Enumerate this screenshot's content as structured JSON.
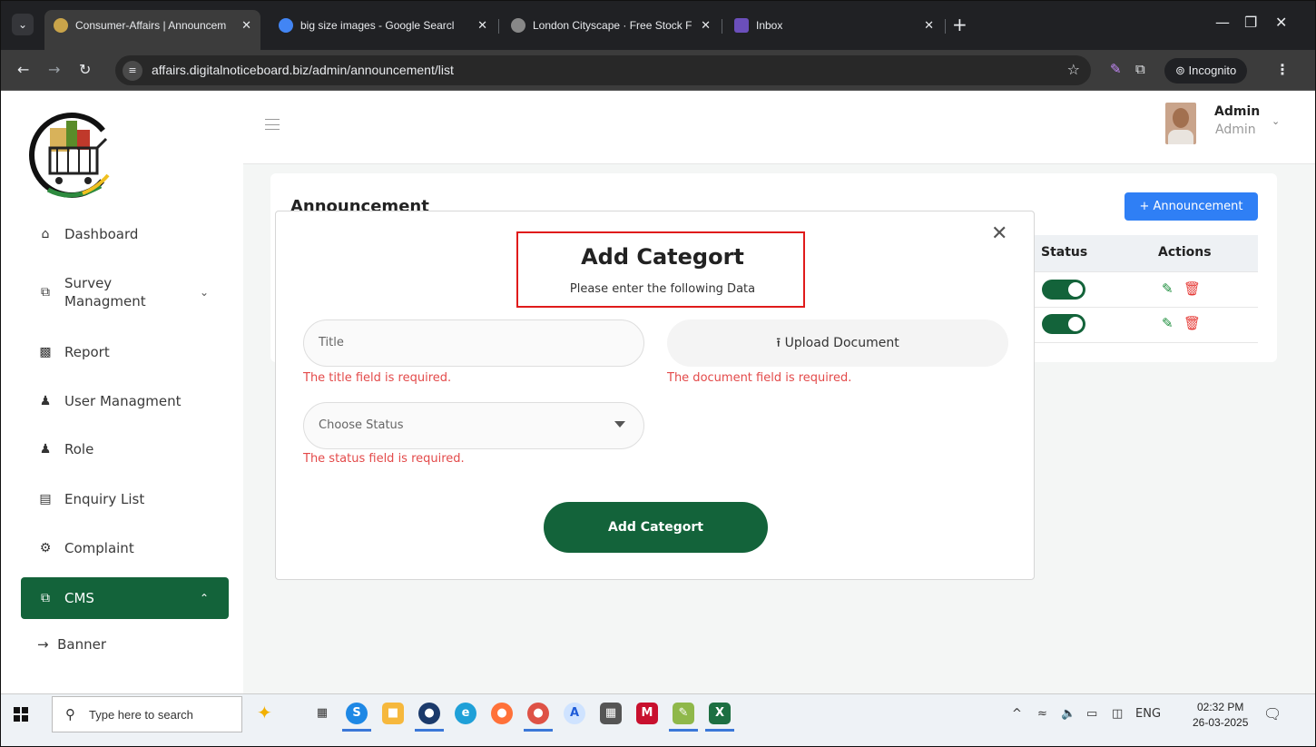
{
  "browser": {
    "tabs": [
      {
        "title": "Consumer-Affairs | Announcem",
        "active": true,
        "favicon_color": "#c9a44a"
      },
      {
        "title": "big size images - Google Searcl",
        "active": false,
        "favicon_color": "#4285f4"
      },
      {
        "title": "London Cityscape · Free Stock F",
        "active": false,
        "favicon_color": "#888888"
      },
      {
        "title": "Inbox",
        "active": false,
        "favicon_color": "#6b4fbb"
      }
    ],
    "url": "affairs.digitalnoticeboard.biz/admin/announcement/list",
    "incognito_label": "Incognito"
  },
  "sidebar": {
    "items": [
      {
        "label": "Dashboard",
        "icon": "home-icon"
      },
      {
        "label": "Survey Managment",
        "icon": "copy-icon"
      },
      {
        "label": "Report",
        "icon": "report-icon"
      },
      {
        "label": "User Managment",
        "icon": "users-icon"
      },
      {
        "label": "Role",
        "icon": "role-icon"
      },
      {
        "label": "Enquiry List",
        "icon": "id-card-icon"
      },
      {
        "label": "Complaint",
        "icon": "gear-icon"
      },
      {
        "label": "CMS",
        "icon": "copy-icon",
        "active": true
      }
    ],
    "sub_item": "Banner"
  },
  "header": {
    "user_name": "Admin",
    "user_role": "Admin"
  },
  "page": {
    "title": "Announcement",
    "add_button": "+ Announcement",
    "table": {
      "headers": [
        "Status",
        "Actions"
      ],
      "rows": [
        {
          "status_on": true
        },
        {
          "status_on": true
        }
      ]
    }
  },
  "modal": {
    "title": "Add Categort",
    "subtitle": "Please enter the following Data",
    "title_placeholder": "Title",
    "title_error": "The title field is required.",
    "upload_label": "Upload Document",
    "document_error": "The document field is required.",
    "status_placeholder": "Choose Status",
    "status_error": "The status field is required.",
    "submit_label": "Add Categort"
  },
  "taskbar": {
    "search_placeholder": "Type here to search",
    "language": "ENG",
    "time": "02:32 PM",
    "date": "26-03-2025"
  },
  "colors": {
    "brand_green": "#13633a",
    "accent_blue": "#2f7ff5",
    "error_red": "#e34a4a",
    "highlight_red": "#e01b1b"
  }
}
